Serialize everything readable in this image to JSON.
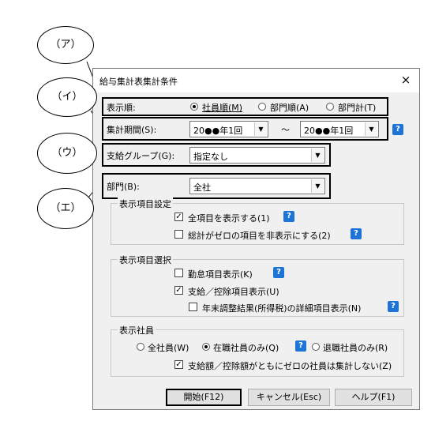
{
  "dialog": {
    "title": "給与集計表集計条件",
    "close_glyph": "×"
  },
  "order": {
    "label": "表示順:",
    "options": [
      {
        "label": "社員順(M)",
        "selected": true
      },
      {
        "label": "部門順(A)",
        "selected": false
      },
      {
        "label": "部門計(T)",
        "selected": false
      }
    ]
  },
  "period": {
    "label": "集計期間(S):",
    "from": "20●●年1回",
    "tilde": "～",
    "to": "20●●年1回"
  },
  "payment_group": {
    "label": "支給グループ(G):",
    "value": "指定なし"
  },
  "department": {
    "label": "部門(B):",
    "value": "全社"
  },
  "display_items": {
    "title": "表示項目設定",
    "show_all": {
      "label": "全項目を表示する(1)",
      "checked": true
    },
    "hide_zero": {
      "label": "総計がゼロの項目を非表示にする(2)",
      "checked": false
    }
  },
  "item_selection": {
    "title": "表示項目選択",
    "attendance": {
      "label": "勤怠項目表示(K)",
      "checked": false
    },
    "payment": {
      "label": "支給／控除項目表示(U)",
      "checked": true
    },
    "year_end": {
      "label": "年末調整結果(所得税)の詳細項目表示(N)",
      "checked": false
    }
  },
  "employees": {
    "title": "表示社員",
    "options": [
      {
        "label": "全社員(W)",
        "selected": false
      },
      {
        "label": "在職社員のみ(Q)",
        "selected": true
      },
      {
        "label": "退職社員のみ(R)",
        "selected": false
      }
    ],
    "exclude_zero": {
      "label": "支給額／控除額がともにゼロの社員は集計しない(Z)",
      "checked": true
    }
  },
  "buttons": {
    "start": "開始(F12)",
    "cancel": "キャンセル(Esc)",
    "help": "ヘルプ(F1)"
  },
  "help_glyph": "?",
  "check_glyph": "✓",
  "dropdown_glyph": "▼",
  "callouts": [
    "（ア）",
    "（イ）",
    "（ウ）",
    "（エ）"
  ]
}
